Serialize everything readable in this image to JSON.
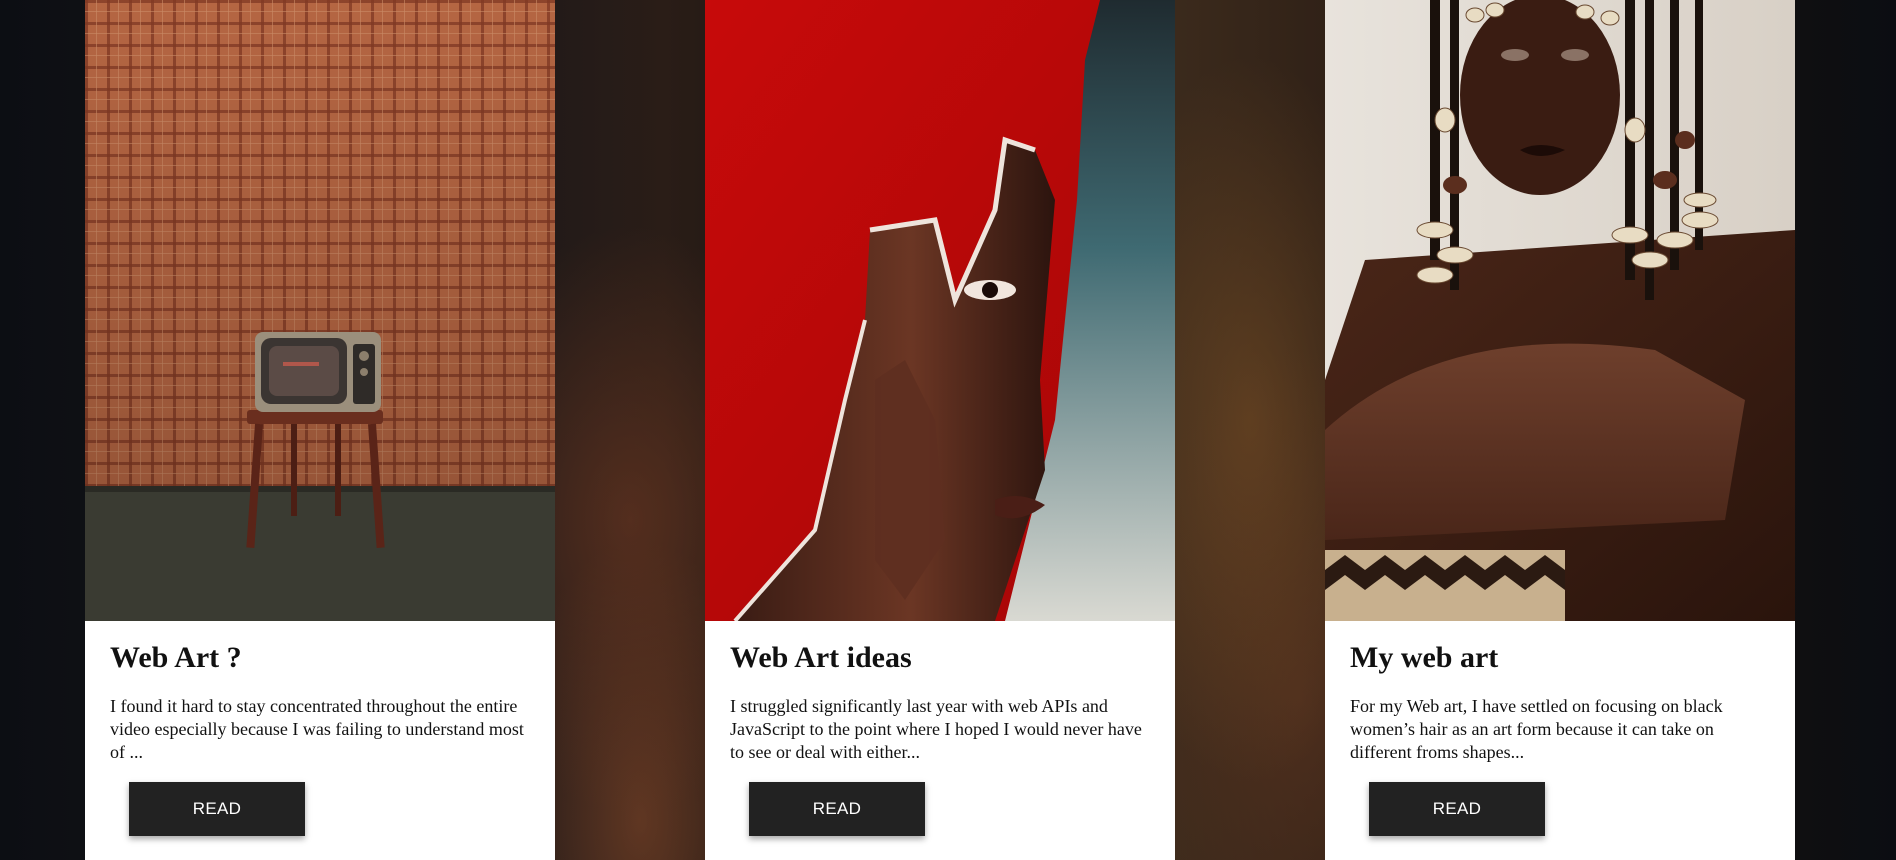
{
  "cards": [
    {
      "title": "Web Art ?",
      "text": "I found it hard to stay concentrated throughout the entire video especially because I was failing to understand most of ...",
      "button": "READ",
      "image": "retro-tv-on-stool-photo"
    },
    {
      "title": "Web Art ideas",
      "text": "I struggled significantly last year with web APIs and JavaScript to the point where I hoped I would never have to see or deal with either...",
      "button": "READ",
      "image": "torn-red-poster-face-photo"
    },
    {
      "title": "My web art",
      "text": "For my Web art, I have settled on focusing on black women’s hair as an art form because it can take on different froms shapes...",
      "button": "READ",
      "image": "beaded-braids-portrait-photo"
    }
  ],
  "colors": {
    "button_bg": "#222222",
    "button_text": "#ffffff",
    "card_bg": "#ffffff"
  }
}
